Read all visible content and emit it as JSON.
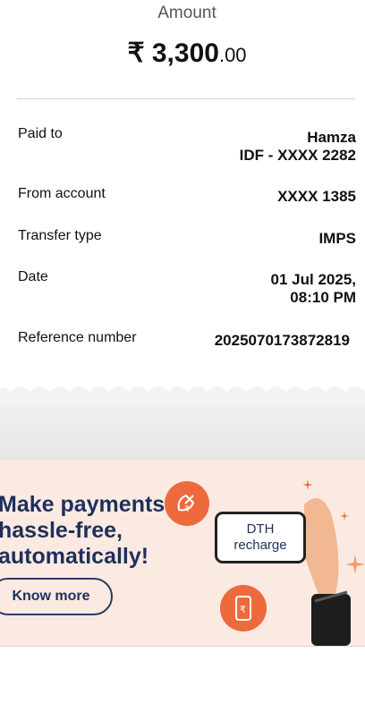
{
  "summary": {
    "amount_label": "Amount",
    "amount_main": "₹ 3,300",
    "amount_decimal": ".00"
  },
  "details": [
    {
      "label": "Paid to",
      "value_lines": [
        "Hamza",
        "IDF - XXXX 2282"
      ]
    },
    {
      "label": "From account",
      "value_lines": [
        "XXXX 1385"
      ]
    },
    {
      "label": "Transfer type",
      "value_lines": [
        "IMPS"
      ]
    },
    {
      "label": "Date",
      "value_lines": [
        "01 Jul 2025,",
        "08:10 PM"
      ]
    },
    {
      "label": "Reference number",
      "value_lines": [
        "2025070173872819"
      ]
    }
  ],
  "banner": {
    "headline_lines": [
      "Make payments",
      "hassle-free,",
      "automatically!"
    ],
    "button_label": "Know more",
    "phone_text_lines": [
      "DTH",
      "recharge"
    ],
    "icons": [
      "satellite-dish-rupee-icon",
      "phone-rupee-icon"
    ]
  },
  "colors": {
    "banner_bg": "#fbeae2",
    "accent_orange": "#ee6a3c",
    "headline_navy": "#1f2f5c"
  }
}
